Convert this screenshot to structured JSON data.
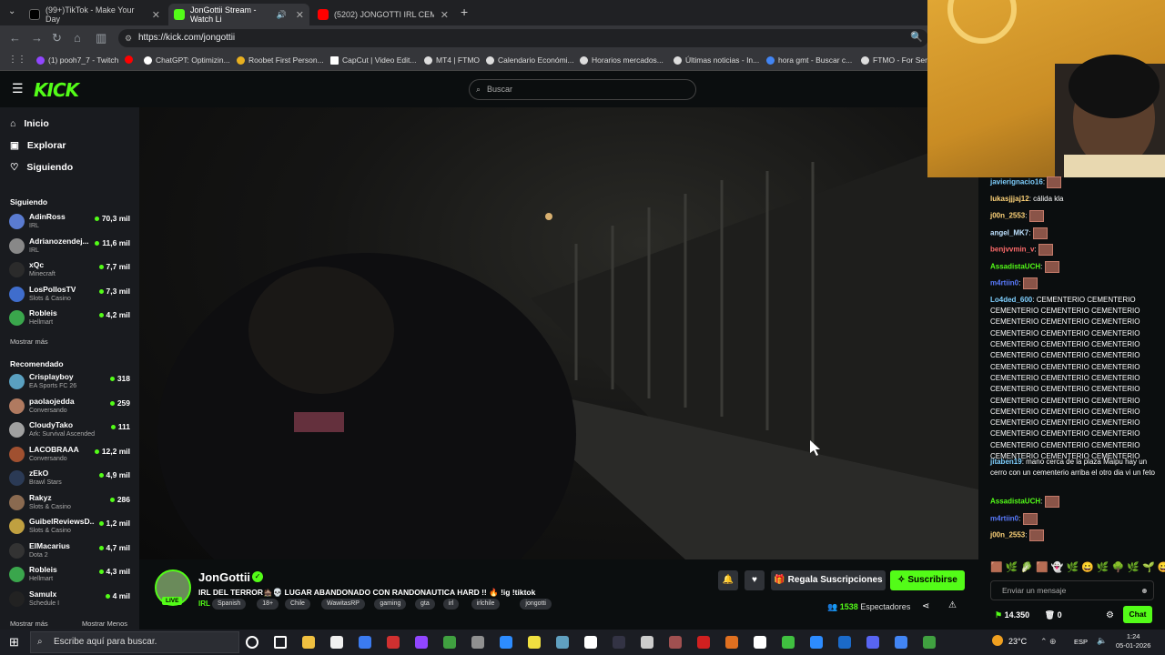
{
  "browser": {
    "tabs": [
      {
        "label": "(99+)TikTok - Make Your Day",
        "color": "#ffffff"
      },
      {
        "label": "JonGottii Stream - Watch Li",
        "color": "#53fc18"
      },
      {
        "label": "(5202) JONGOTTI IRL CEMENT",
        "color": "#ff0000"
      }
    ],
    "url": "https://kick.com/jongottii",
    "bookmarks": [
      {
        "label": "(1) pooh7_7 - Twitch",
        "color": "#9146ff"
      },
      {
        "label": "",
        "color": "#ff0000"
      },
      {
        "label": "ChatGPT: Optimizin...",
        "color": "#ffffff"
      },
      {
        "label": "Roobet First Person...",
        "color": "#e8b020"
      },
      {
        "label": "CapCut | Video Edit...",
        "color": "#ffffff"
      },
      {
        "label": "MT4 | FTMO",
        "color": "#dddddd"
      },
      {
        "label": "Calendario Económi...",
        "color": "#dddddd"
      },
      {
        "label": "Horarios mercados...",
        "color": "#dddddd"
      },
      {
        "label": "Últimas noticias - In...",
        "color": "#dddddd"
      },
      {
        "label": "hora gmt - Buscar c...",
        "color": "#4285f4"
      },
      {
        "label": "FTMO - For Serio",
        "color": "#dddddd"
      }
    ]
  },
  "kick": {
    "logo": "KICK",
    "search_placeholder": "Buscar"
  },
  "sidebar": {
    "nav": [
      {
        "label": "Inicio",
        "icon": "⌂"
      },
      {
        "label": "Explorar",
        "icon": "▣"
      },
      {
        "label": "Siguiendo",
        "icon": "♡"
      }
    ],
    "following_title": "Siguiendo",
    "following": [
      {
        "name": "AdinRoss",
        "category": "IRL",
        "viewers": "70,3 mil",
        "color": "#5a7bd0"
      },
      {
        "name": "Adrianozendej...",
        "category": "IRL",
        "viewers": "11,6 mil",
        "color": "#888888"
      },
      {
        "name": "xQc",
        "category": "Minecraft",
        "viewers": "7,7 mil",
        "color": "#2b2b2b"
      },
      {
        "name": "LosPollosTV",
        "category": "Slots & Casino",
        "viewers": "7,3 mil",
        "color": "#3f6dcc"
      },
      {
        "name": "Robleis",
        "category": "Hellmart",
        "viewers": "4,2 mil",
        "color": "#3aa64c"
      }
    ],
    "show_more": "Mostrar más",
    "recommended_title": "Recomendado",
    "recommended": [
      {
        "name": "Crisplayboy",
        "category": "EA Sports FC 26",
        "viewers": "318",
        "color": "#5aa0c0"
      },
      {
        "name": "paolaojedda",
        "category": "Conversando",
        "viewers": "259",
        "color": "#b07a60"
      },
      {
        "name": "CloudyTako",
        "category": "Ark: Survival Ascended",
        "viewers": "111",
        "color": "#a0a0a0"
      },
      {
        "name": "LACOBRAAA",
        "category": "Conversando",
        "viewers": "12,2 mil",
        "color": "#a05030"
      },
      {
        "name": "zEkO",
        "category": "Brawl Stars",
        "viewers": "4,9 mil",
        "color": "#2b3a55"
      },
      {
        "name": "Rakyz",
        "category": "Slots & Casino",
        "viewers": "286",
        "color": "#8a6a50"
      },
      {
        "name": "GuibelReviewsD...",
        "category": "Slots & Casino",
        "viewers": "1,2 mil",
        "color": "#c0a040"
      },
      {
        "name": "ElMacarius",
        "category": "Dota 2",
        "viewers": "4,7 mil",
        "color": "#333333"
      },
      {
        "name": "Robleis",
        "category": "Hellmart",
        "viewers": "4,3 mil",
        "color": "#3aa64c"
      },
      {
        "name": "Samulx",
        "category": "Schedule I",
        "viewers": "4 mil",
        "color": "#222222"
      }
    ],
    "show_more_bottom": "Mostrar más",
    "show_less": "Mostrar Menos"
  },
  "stream": {
    "name": "JonGottii",
    "live": "LIVE",
    "title": "IRL DEL TERROR🏚️💀 LUGAR ABANDONADO CON RANDONAUTICA HARD !! 🔥 !ig !tiktok",
    "category": "IRL",
    "tags": [
      "Spanish",
      "18+",
      "Chile",
      "WawitasRP",
      "gaming",
      "gta",
      "irl",
      "irlchile",
      "jongotti"
    ],
    "gift_label": "Regala Suscripciones",
    "subscribe_label": "Suscribirse",
    "viewers": "1538",
    "viewers_label": "Espectadores"
  },
  "chat": {
    "messages": [
      {
        "user": "javierignacio16",
        "color": "#7fd0ff",
        "text": "",
        "emote": true
      },
      {
        "user": "lukasjjjaj12",
        "color": "#ffd479",
        "text": "cálida kla",
        "emote": false
      },
      {
        "user": "j00n_2553",
        "color": "#ffd479",
        "text": "",
        "emote": true
      },
      {
        "user": "angel_MK7",
        "color": "#bde1ff",
        "text": "",
        "emote": true
      },
      {
        "user": "benjvvmin_v",
        "color": "#ff6b6b",
        "text": "",
        "emote": true
      },
      {
        "user": "AssadistaUCH",
        "color": "#53fc18",
        "text": "",
        "emote": true
      },
      {
        "user": "m4rtiin0",
        "color": "#5a7bff",
        "text": "",
        "emote": true
      },
      {
        "user": "Lo4ded_600",
        "color": "#7fd0ff",
        "text": "CEMENTERIO CEMENTERIO CEMENTERIO CEMENTERIO CEMENTERIO CEMENTERIO CEMENTERIO CEMENTERIO CEMENTERIO CEMENTERIO CEMENTERIO CEMENTERIO CEMENTERIO CEMENTERIO CEMENTERIO CEMENTERIO CEMENTERIO CEMENTERIO CEMENTERIO CEMENTERIO CEMENTERIO CEMENTERIO CEMENTERIO CEMENTERIO CEMENTERIO CEMENTERIO CEMENTERIO CEMENTERIO CEMENTERIO CEMENTERIO CEMENTERIO CEMENTERIO CEMENTERIO CEMENTERIO CEMENTERIO CEMENTERIO CEMENTERIO CEMENTERIO CEMENTERIO CEMENTERIO CEMENTERIO CEMENTERIO CEMENTERIO CEMENTERIO",
        "emote": false
      },
      {
        "user": "jitaben19",
        "color": "#7fd0ff",
        "text": "mano cerca de la plaza Maipu hay un cerro con un cementerio arriba el otro dia vi un feto",
        "emote": false
      },
      {
        "user": "AssadistaUCH",
        "color": "#53fc18",
        "text": "",
        "emote": true
      },
      {
        "user": "m4rtiin0",
        "color": "#5a7bff",
        "text": "",
        "emote": true
      },
      {
        "user": "j00n_2553",
        "color": "#ffd479",
        "text": "",
        "emote": true
      }
    ],
    "emote_bar": "🟫🌿🥬🟫👻🌿😀🌿🌳🌿🌱😀",
    "input_placeholder": "Enviar un mensaje",
    "points": "14.350",
    "drops": "0",
    "chat_label": "Chat"
  },
  "taskbar": {
    "search_placeholder": "Escribe aquí para buscar.",
    "weather": "23°C",
    "lang": "ESP",
    "time": "1:24",
    "date": "05-01-2026"
  }
}
